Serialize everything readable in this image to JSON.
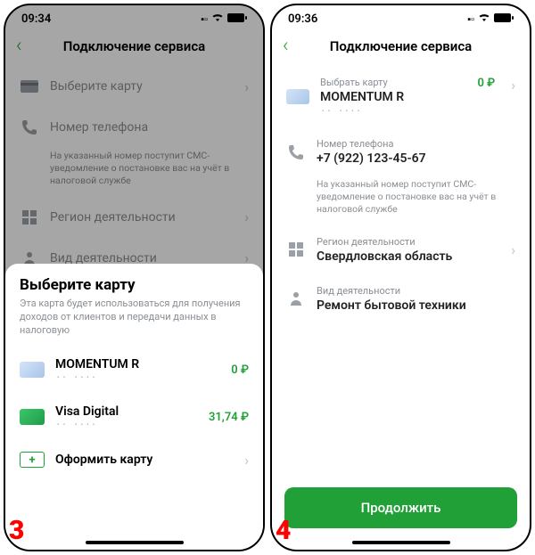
{
  "screen3": {
    "time": "09:34",
    "title": "Подключение сервиса",
    "rows": {
      "card_label": "Выберите карту",
      "phone_label": "Номер телефона",
      "helper": "На указанный номер поступит СМС-уведомление о постановке вас на учёт в налоговой службе",
      "region_label": "Регион деятельности",
      "activity_label": "Вид деятельности"
    },
    "sheet": {
      "title": "Выберите карту",
      "sub": "Эта карта будет использоваться для получения доходов от клиентов и передачи данных в налоговую",
      "cards": [
        {
          "name": "MOMENTUM R",
          "mask": "·· ····",
          "balance": "0 ₽"
        },
        {
          "name": "Visa Digital",
          "mask": "·· ····",
          "balance": "31,74 ₽"
        }
      ],
      "new": "Оформить карту"
    },
    "step": "3"
  },
  "screen4": {
    "time": "09:36",
    "title": "Подключение сервиса",
    "card": {
      "label": "Выбрать карту",
      "name": "MOMENTUM R",
      "mask": "·· ····",
      "balance": "0 ₽"
    },
    "phone": {
      "label": "Номер телефона",
      "value": "+7 (922) 123-45-67"
    },
    "helper": "На указанный номер поступит СМС-уведомление о постановке вас на учёт в налоговой службе",
    "region": {
      "label": "Регион деятельности",
      "value": "Свердловская область"
    },
    "activity": {
      "label": "Вид деятельности",
      "value": "Ремонт бытовой техники"
    },
    "cta": "Продолжить",
    "step": "4"
  }
}
